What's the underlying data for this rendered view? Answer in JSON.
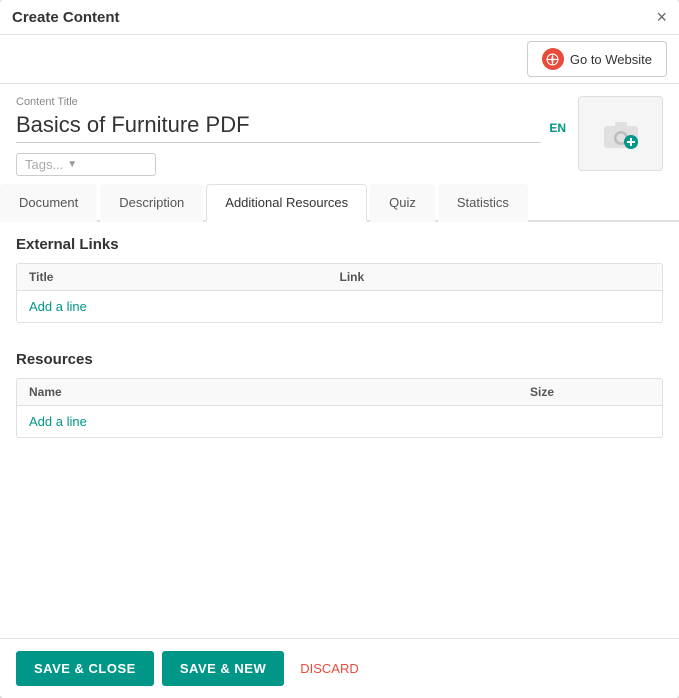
{
  "modal": {
    "title": "Create Content",
    "close_label": "×"
  },
  "header": {
    "go_to_website_label": "Go to Website"
  },
  "form": {
    "content_title_label": "Content Title",
    "content_title_value": "Basics of Furniture PDF",
    "lang_tag": "EN",
    "tags_placeholder": "Tags..."
  },
  "tabs": [
    {
      "id": "document",
      "label": "Document",
      "active": false
    },
    {
      "id": "description",
      "label": "Description",
      "active": false
    },
    {
      "id": "additional-resources",
      "label": "Additional Resources",
      "active": true
    },
    {
      "id": "quiz",
      "label": "Quiz",
      "active": false
    },
    {
      "id": "statistics",
      "label": "Statistics",
      "active": false
    }
  ],
  "external_links": {
    "section_title": "External Links",
    "columns": [
      "Title",
      "Link"
    ],
    "add_line_label": "Add a line"
  },
  "resources": {
    "section_title": "Resources",
    "columns": [
      "Name",
      "Size"
    ],
    "add_line_label": "Add a line"
  },
  "footer": {
    "save_close_label": "SAVE & CLOSE",
    "save_new_label": "SAVE & NEW",
    "discard_label": "DISCARD"
  }
}
